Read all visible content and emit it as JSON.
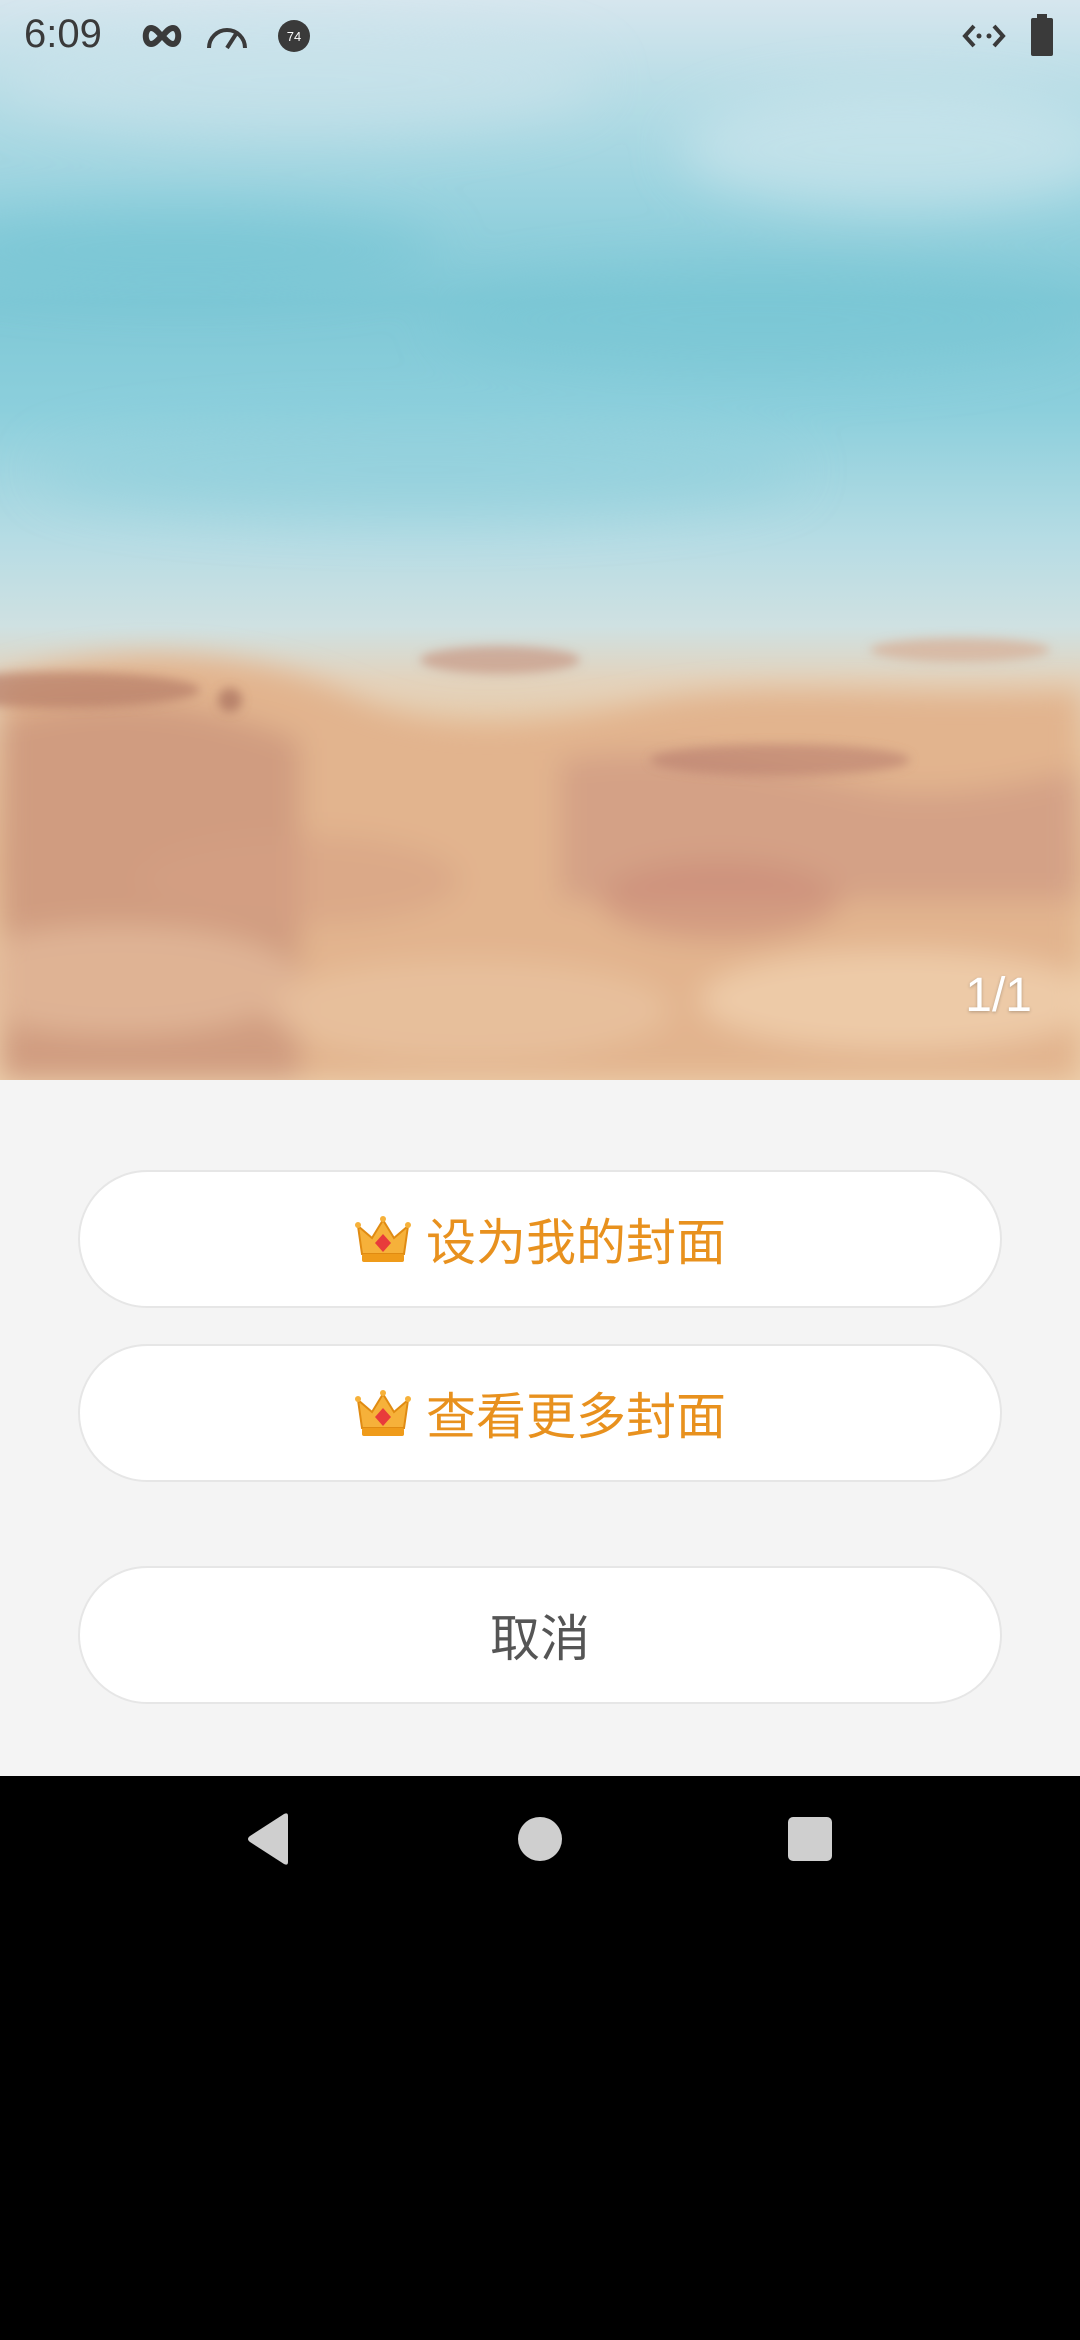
{
  "status_bar": {
    "time": "6:09",
    "left_icons": [
      "infinity-icon",
      "speedometer-icon",
      "notification-badge-icon"
    ],
    "badge_number": "74",
    "right_icons": [
      "code-arrows-icon",
      "battery-icon"
    ]
  },
  "cover": {
    "counter": "1/1"
  },
  "action_sheet": {
    "set_cover_label": "设为我的封面",
    "more_covers_label": "查看更多封面",
    "cancel_label": "取消",
    "accent_color": "#e8911e"
  },
  "nav_bar": {
    "buttons": [
      "back-icon",
      "home-icon",
      "recents-icon"
    ]
  }
}
